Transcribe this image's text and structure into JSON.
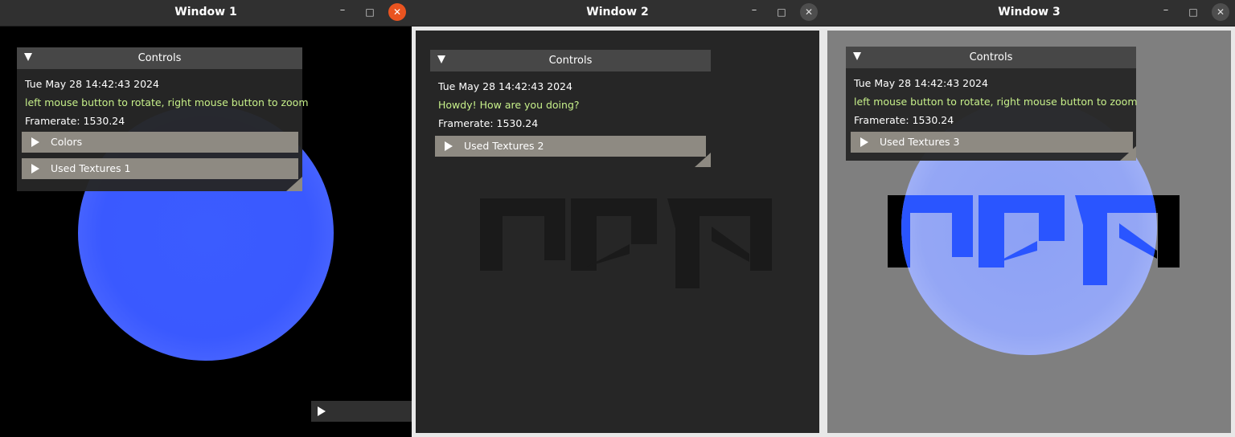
{
  "windows": [
    {
      "title": "Window 1",
      "panel": {
        "title": "Controls",
        "date": "Tue May 28 14:42:43 2024",
        "hint": "left mouse button to rotate, right mouse button to zoom",
        "framerate": "Framerate: 1530.24",
        "items": [
          "Colors",
          "Used Textures 1"
        ]
      }
    },
    {
      "title": "Window 2",
      "panel": {
        "title": "Controls",
        "date": "Tue May 28 14:42:43 2024",
        "hint": "Howdy! How are you doing?",
        "framerate": "Framerate: 1530.24",
        "items": [
          "Used Textures 2"
        ]
      }
    },
    {
      "title": "Window 3",
      "panel": {
        "title": "Controls",
        "date": "Tue May 28 14:42:43 2024",
        "hint": "left mouse button to rotate, right mouse button to zoom",
        "framerate": "Framerate: 1530.24",
        "items": [
          "Used Textures 3"
        ]
      }
    }
  ],
  "window_buttons": {
    "minimize": "–",
    "maximize": "□",
    "close": "✕"
  },
  "icons": {
    "expanded": "triangle-down-icon",
    "collapsed": "triangle-right-icon",
    "resize": "resize-grip-icon"
  },
  "colors": {
    "close_active": "#e95420",
    "globe_blue": "#3a5cff",
    "hint_green": "#c7f08a",
    "tree_node": "#8e8a82"
  }
}
